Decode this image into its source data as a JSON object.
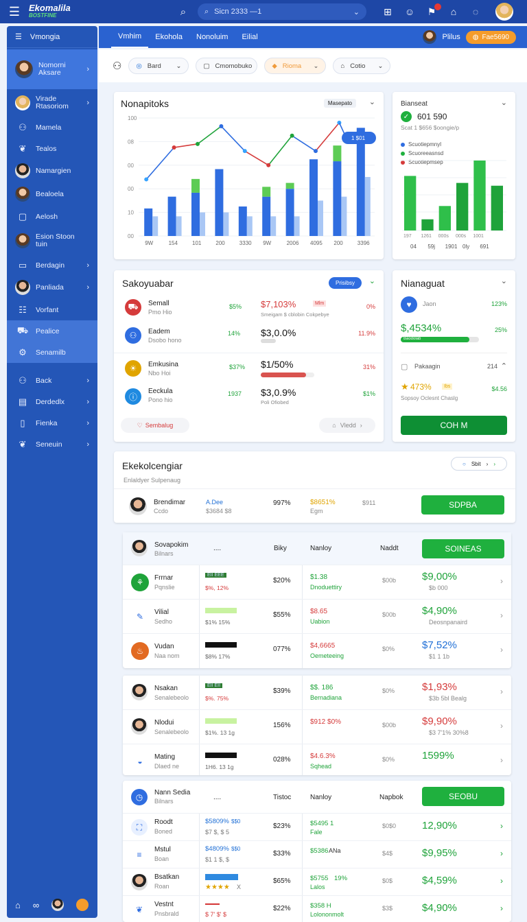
{
  "topbar": {
    "brand": "Ekomalila",
    "brand_sub": "BOSTFINE",
    "search_value": "Sicn 2333 —1"
  },
  "sidebar": {
    "header": "Vmongia",
    "items": [
      {
        "label": "Nomorni Aksare",
        "icon": "avatar"
      },
      {
        "label": "Virade Rtasoriom",
        "icon": "avatar"
      },
      {
        "label": "Mamela",
        "icon": "user-icon"
      },
      {
        "label": "Tealos",
        "icon": "leaf-icon"
      },
      {
        "label": "Namargien",
        "icon": "avatar"
      },
      {
        "label": "Bealoela",
        "icon": "avatar"
      },
      {
        "label": "Aelosh",
        "icon": "box-icon"
      },
      {
        "label": "Esion Stoon tuin",
        "icon": "avatar"
      },
      {
        "label": "Berdagin",
        "icon": "card-icon"
      },
      {
        "label": "Panliada",
        "icon": "avatar"
      },
      {
        "label": "Vorfant",
        "icon": "list-icon"
      },
      {
        "label": "Pealice",
        "icon": "cart-icon"
      },
      {
        "label": "Senamilb",
        "icon": "gear-icon"
      },
      {
        "label": "Back",
        "icon": "user-icon"
      },
      {
        "label": "Derdedlx",
        "icon": "chart-icon"
      },
      {
        "label": "Fienka",
        "icon": "doc-icon"
      },
      {
        "label": "Seneuin",
        "icon": "leaf-icon"
      }
    ]
  },
  "nav": {
    "tabs": [
      "Vmhim",
      "Ekohola",
      "Nonoluim",
      "Eilial"
    ],
    "user": "Plilus",
    "pill": "Fae5690"
  },
  "filters": {
    "f1": "Bard",
    "f2": "Cmomobuko",
    "f3": "Rioma",
    "f4": "Cotio"
  },
  "chart1": {
    "title": "Nonapitoks",
    "dropdown": "Masepato",
    "callout": "1 $01",
    "chart_data": {
      "type": "bar",
      "title": "Nonapitoks",
      "yticks": [
        "00",
        "10",
        "00",
        "00",
        "08",
        "100"
      ],
      "categories": [
        "0W",
        "1h6",
        "101",
        "200",
        "300",
        "2W",
        "200",
        "400",
        "200",
        "300"
      ],
      "categories_labels": [
        "9W",
        "154",
        "101",
        "200",
        "3330",
        "9W",
        "2006",
        "4095",
        "200",
        "3396"
      ],
      "series": [
        {
          "values": [
            14,
            20,
            22,
            34,
            15,
            20,
            24,
            39,
            38,
            55
          ]
        },
        {
          "values": [
            10,
            10,
            12,
            12,
            10,
            10,
            10,
            18,
            20,
            30
          ]
        },
        {
          "values": [
            0,
            0,
            7,
            0,
            0,
            5,
            3,
            0,
            8,
            0
          ]
        },
        {
          "values": [
            48,
            75,
            78,
            93,
            72,
            60,
            85,
            72,
            96,
            0
          ]
        }
      ]
    }
  },
  "chart2": {
    "title": "Bianseat",
    "value": "601 590",
    "sub": "Scat 1 $656 $oongie/p",
    "legend": [
      "Scuotiepmnyl",
      "Scuoreeasnsd",
      "Scuotiepmsep"
    ],
    "legend_colors": [
      "#2f6de0",
      "#1fb03e",
      "#d53b3b"
    ],
    "chart_data": {
      "type": "bar",
      "categories": [
        "04",
        "59j",
        "1901",
        "0ly",
        "691"
      ],
      "categories_top": [
        "197",
        "1261",
        "000s",
        "000s",
        "1001"
      ],
      "values": [
        78,
        16,
        35,
        68,
        100,
        64
      ]
    }
  },
  "sales": {
    "title": "Sakoyuabar",
    "pill": "Prisibsy",
    "rows": [
      {
        "name": "Semall",
        "sub": "Pmo Hio",
        "pct": "$5%",
        "amount": "$7,103%",
        "tag": "Mlm",
        "desc": "Smeigam $ cblobin Cokpebye",
        "change": "0%"
      },
      {
        "name": "Eadem",
        "sub": "Dsobo hono",
        "pct": "14%",
        "amount": "$3,0.0%",
        "tag": "",
        "desc": "",
        "change": "11.9%"
      },
      {
        "name": "Emkusina",
        "sub": "Nbo Hoi",
        "pct": "$37%",
        "amount": "$1/50%",
        "tag": "",
        "desc": "",
        "change": "31%"
      },
      {
        "name": "Eeckula",
        "sub": "Pono hio",
        "pct": "1937",
        "amount": "$3,0.9%",
        "tag": "",
        "desc": "Poli Ofiobed",
        "change": "$1%"
      }
    ],
    "btn_left": "Sembalug",
    "btn_right": "Vledd"
  },
  "rightpanel": {
    "title": "Nianaguat",
    "r1_label": "Jaon",
    "r1_value": "123%",
    "big": "$,4534%",
    "big_change": "25%",
    "bar_label": "Baodolab",
    "r3_label": "Pakaagin",
    "r3_value": "214",
    "r4_value": "473%",
    "r4_tag": "Ibs",
    "r4_desc": "Sopsoy Oclesnt Chaslg",
    "r4_right": "$4.56",
    "button": "COH M"
  },
  "ekoko": {
    "title": "Ekekolcengiar",
    "sub": "Enlaldyer Sulpenaug",
    "control": "Sbit",
    "row": {
      "name": "Brendimar",
      "sub": "Ccdo",
      "col2": "A.Dee",
      "col2b": "$3684 $8",
      "pct": "997%",
      "amt": "$8651%",
      "amt_sub": "Egm",
      "gray": "$911",
      "button": "SDPBA"
    }
  },
  "table1": {
    "header_name": "Sovapokim",
    "header_sub": "Bilnars",
    "col1": "Biky",
    "col2": "Nanloy",
    "col3": "Naddt",
    "button": "SOINEAS",
    "rows": [
      {
        "name": "Frrnar",
        "sub": "Pqnslie",
        "tag": "EII EEE",
        "change": "$%, 12%",
        "pct": "$20%",
        "amt": "$1.38",
        "amt_sub": "Dnoduettiry",
        "gray": "$00b",
        "val": "$9,00%",
        "val_sub": "$b 000"
      },
      {
        "name": "Vilial",
        "sub": "Sedho",
        "tag": "",
        "change": "$1% 15%",
        "pct": "$55%",
        "amt": "$8.65",
        "amt_sub": "Uabion",
        "gray": "$00b",
        "val": "$4,90%",
        "val_sub": "Deosnpanaird"
      },
      {
        "name": "Vudan",
        "sub": "Naa nom",
        "tag": "",
        "change": "$8% 17%",
        "pct": "077%",
        "amt": "$4,6665",
        "amt_sub": "Oemeteeing",
        "gray": "$0%",
        "val": "$7,52%",
        "val_sub": "$1 1 1b"
      }
    ]
  },
  "table2": {
    "rows": [
      {
        "name": "Nsakan",
        "sub": "Senalebeolo",
        "tag": "EII EII",
        "change": "$%. 75%",
        "pct": "$39%",
        "amt": "$$. 186",
        "amt_sub": "Bernadiana",
        "gray": "$0%",
        "val": "$1,93%",
        "val_sub": "$3b 5bl Bealg"
      },
      {
        "name": "Nlodui",
        "sub": "Senalebeolo",
        "tag": "",
        "change": "$1%. 13 1g",
        "pct": "156%",
        "amt": "$912 $0%",
        "amt_sub": "",
        "gray": "$00b",
        "val": "$9,90%",
        "val_sub": "$3 7'1% 30%8"
      },
      {
        "name": "Mating",
        "sub": "Dlaed ne",
        "tag": "",
        "change": "1H6. 13 1g",
        "pct": "028%",
        "amt": "$4.6.3%",
        "amt_sub": "Sqhead",
        "gray": "$0%",
        "val": "1599%",
        "val_sub": ""
      }
    ]
  },
  "table3": {
    "header_name": "Nann Sedia",
    "header_sub": "Bilnars",
    "col1": "Tistoc",
    "col2": "Nanloy",
    "col3": "Napbok",
    "button": "SEOBU",
    "rows": [
      {
        "name": "Roodt",
        "sub": "Boned",
        "blue": "$5809%",
        "blue2": "$$0",
        "blue_sub": "$7 $, $ 5",
        "pct": "$23%",
        "amt": "$5495 1",
        "amt_sub": "Fale",
        "gray": "$0$0",
        "val": "12,90%"
      },
      {
        "name": "Mstul",
        "sub": "Boan",
        "blue": "$4809%",
        "blue2": "$$0",
        "blue_sub": "$1 1 $, $",
        "pct": "$33%",
        "amt": "$5386",
        "amt_sub": "ANa",
        "gray": "$4$",
        "val": "$9,95%"
      },
      {
        "name": "Bsatkan",
        "sub": "Roan",
        "blue": "",
        "blue2": "",
        "blue_sub": "X",
        "pct": "$65%",
        "amt": "$5755",
        "amt2": "19%",
        "amt_sub": "Lalos",
        "gray": "$0$",
        "val": "$4,59%"
      },
      {
        "name": "Vestnt",
        "sub": "Pnsbrald",
        "blue": "",
        "blue2": "",
        "blue_sub": "$ 7' $' $",
        "pct": "$22%",
        "amt": "$358 H",
        "amt_sub": "Lolononmolt",
        "gray": "$3$",
        "val": "$4,90%"
      }
    ]
  }
}
